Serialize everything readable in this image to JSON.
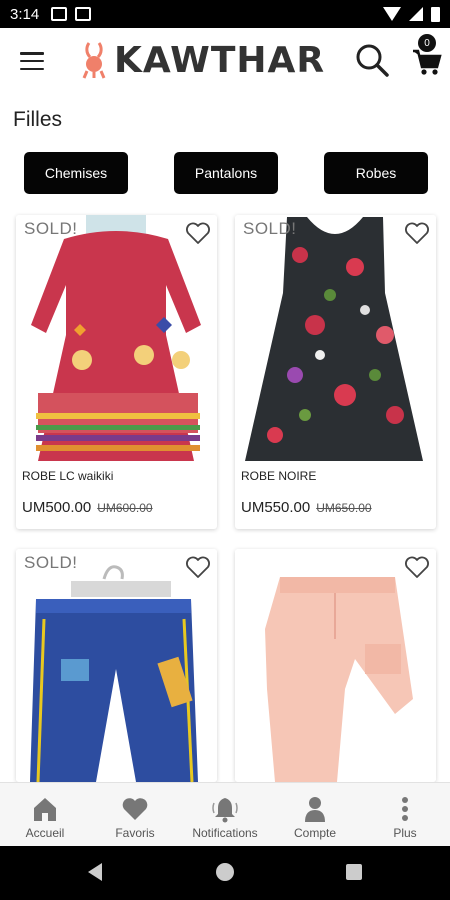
{
  "status_bar": {
    "time": "3:14"
  },
  "header": {
    "brand": "KAWTHAR",
    "cart_count": "0"
  },
  "section": {
    "title": "Filles"
  },
  "categories": [
    {
      "label": "Chemises"
    },
    {
      "label": "Pantalons"
    },
    {
      "label": "Robes"
    }
  ],
  "products": [
    {
      "badge": "SOLD!",
      "name": "ROBE LC waikiki",
      "price": "UM500.00",
      "old_price": "UM600.00"
    },
    {
      "badge": "SOLD!",
      "name": "ROBE NOIRE",
      "price": "UM550.00",
      "old_price": "UM650.00"
    },
    {
      "badge": "SOLD!",
      "name": "",
      "price": "",
      "old_price": ""
    },
    {
      "badge": "",
      "name": "",
      "price": "",
      "old_price": ""
    }
  ],
  "bottom_nav": [
    {
      "label": "Accueil",
      "icon": "home-icon"
    },
    {
      "label": "Favoris",
      "icon": "heart-icon"
    },
    {
      "label": "Notifications",
      "icon": "bell-icon"
    },
    {
      "label": "Compte",
      "icon": "person-icon"
    },
    {
      "label": "Plus",
      "icon": "more-vertical-icon"
    }
  ],
  "colors": {
    "button_bg": "#050505",
    "nav_icon": "#777777",
    "brand_accent": "#f0806a"
  }
}
